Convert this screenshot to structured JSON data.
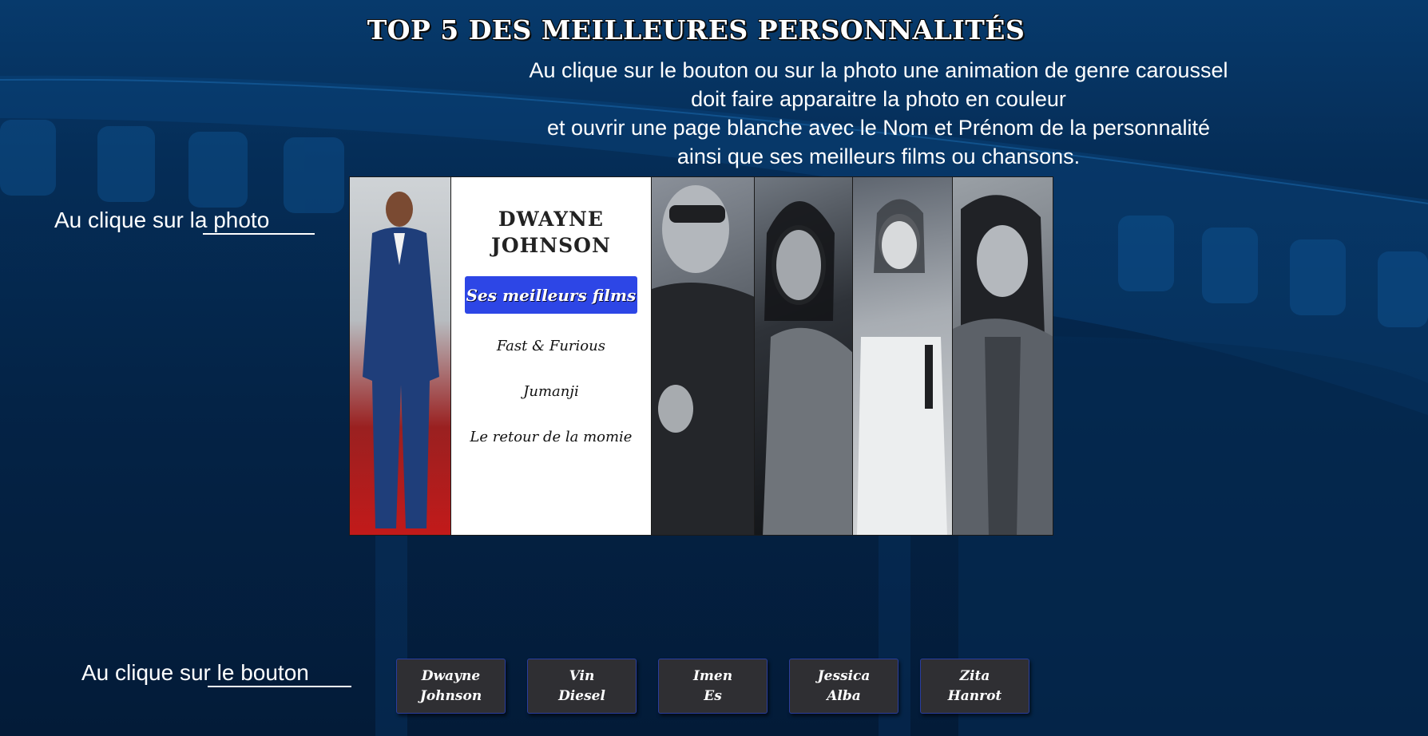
{
  "page": {
    "title": "TOP 5 DES MEILLEURES PERSONNALITÉS",
    "description_lines": [
      "Au clique sur le bouton ou sur la photo une animation de genre caroussel",
      "doit faire apparaitre la photo en couleur",
      "et ouvrir une page blanche avec le Nom et Prénom de la personnalité",
      "ainsi que ses meilleurs films ou chansons."
    ],
    "label_photo": "Au clique sur la photo",
    "label_button": "Au clique sur le bouton"
  },
  "carousel": {
    "active": {
      "name_line1": "DWAYNE",
      "name_line2": "JOHNSON",
      "films_button": "Ses meilleurs films",
      "films": [
        "Fast & Furious",
        "Jumanji",
        "Le retour de la momie"
      ]
    }
  },
  "buttons": [
    {
      "line1": "Dwayne",
      "line2": "Johnson"
    },
    {
      "line1": "Vin",
      "line2": "Diesel"
    },
    {
      "line1": "Imen",
      "line2": "Es"
    },
    {
      "line1": "Jessica",
      "line2": "Alba"
    },
    {
      "line1": "Zita",
      "line2": "Hanrot"
    }
  ],
  "colors": {
    "background": "#042346",
    "films_button": "#2d46e6",
    "person_button": "#2f2f33",
    "person_button_border": "#2a3d9e"
  }
}
